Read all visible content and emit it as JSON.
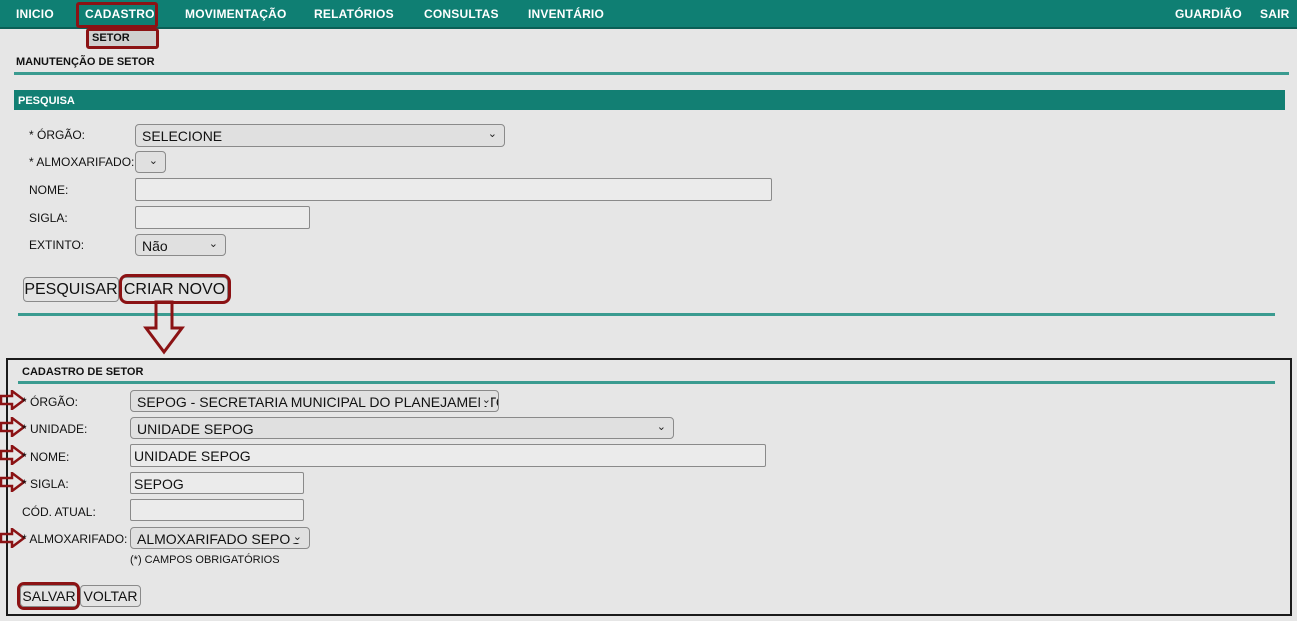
{
  "nav": {
    "items": [
      "INICIO",
      "CADASTRO",
      "MOVIMENTAÇÃO",
      "RELATÓRIOS",
      "CONSULTAS",
      "INVENTÁRIO"
    ],
    "right": [
      "GUARDIÃO",
      "SAIR"
    ],
    "submenu": "SETOR"
  },
  "page_title": "MANUTENÇÃO DE SETOR",
  "pesquisa": {
    "header": "PESQUISA",
    "orgao_label": "* ÓRGÃO:",
    "orgao_value": "SELECIONE",
    "almox_label": "* ALMOXARIFADO:",
    "almox_value": "",
    "nome_label": "NOME:",
    "nome_value": "",
    "sigla_label": "SIGLA:",
    "sigla_value": "",
    "extinto_label": "EXTINTO:",
    "extinto_value": "Não",
    "btn_pesquisar": "PESQUISAR",
    "btn_criar": "CRIAR NOVO"
  },
  "cadastro": {
    "title": "CADASTRO DE SETOR",
    "orgao_label": "* ÓRGÃO:",
    "orgao_value": "SEPOG - SECRETARIA MUNICIPAL DO PLANEJAMENTO, O",
    "unidade_label": "* UNIDADE:",
    "unidade_value": "UNIDADE SEPOG",
    "nome_label": "* NOME:",
    "nome_value": "UNIDADE SEPOG",
    "sigla_label": "* SIGLA:",
    "sigla_value": "SEPOG",
    "cod_label": "CÓD. ATUAL:",
    "cod_value": "",
    "almox_label": "* ALMOXARIFADO:",
    "almox_value": "ALMOXARIFADO SEPOG",
    "note": "(*) CAMPOS OBRIGATÓRIOS",
    "btn_salvar": "SALVAR",
    "btn_voltar": "VOLTAR"
  },
  "colors": {
    "teal": "#0f7f73",
    "highlight": "#8b1214",
    "background": "#e6e6e6"
  },
  "icons": [
    "chevron-down-icon",
    "arrow-right-icon",
    "arrow-down-icon"
  ]
}
